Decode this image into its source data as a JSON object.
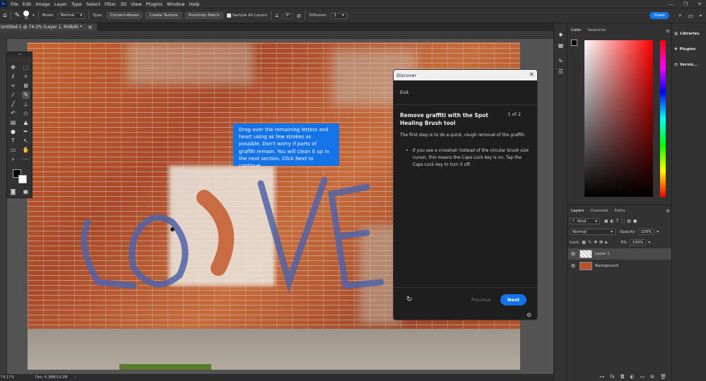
{
  "app": {
    "logo_text": "Ps"
  },
  "menu": [
    "File",
    "Edit",
    "Image",
    "Layer",
    "Type",
    "Select",
    "Filter",
    "3D",
    "View",
    "Plugins",
    "Window",
    "Help"
  ],
  "window_controls": {
    "minimize": "—",
    "restore": "❐",
    "close": "✕"
  },
  "options": {
    "brush_size": "50",
    "mode_label": "Mode:",
    "mode_value": "Normal",
    "type_label": "Type:",
    "type_buttons": [
      "Content-Aware",
      "Create Texture",
      "Proximity Match"
    ],
    "sample_all_layers": "Sample All Layers",
    "angle_value": "0°",
    "diffusion_label": "Diffusion:",
    "diffusion_value": "1",
    "share_label": "Share"
  },
  "document": {
    "tab_title": "Untitled-1 @ 74.2% (Layer 1, RGB/8) *",
    "tab_close": "×",
    "zoom": "74.17%",
    "doc_size": "Doc: 6.38M/10.2M"
  },
  "graffiti_letters": [
    "L",
    "O",
    "V",
    "E"
  ],
  "tooltip": {
    "text": "Drag over the remaining letters and heart using as few strokes as possible. Don't worry if parts of graffiti remain. You will clean it up in the next section. Click Next to continue."
  },
  "discover": {
    "header": "Discover",
    "exit": "Exit",
    "title": "Remove graffiti with the Spot Healing Brush tool",
    "step": "1 of 2",
    "paragraph": "The first step is to do a quick, rough removal of the graffiti.",
    "bullet": "If you see a crosshair instead of the circular brush size cursor, this means the Caps Lock key is on. Tap the Caps Lock key to turn it off.",
    "previous": "Previous",
    "next": "Next"
  },
  "color_panel": {
    "tabs": [
      "Color",
      "Swatches"
    ]
  },
  "layers_panel": {
    "tabs": [
      "Layers",
      "Channels",
      "Paths"
    ],
    "kind_label": "Kind",
    "blend_mode": "Normal",
    "opacity_label": "Opacity:",
    "opacity_value": "100%",
    "lock_label": "Lock:",
    "fill_label": "Fill:",
    "fill_value": "100%",
    "layers": [
      {
        "name": "Layer 1",
        "selected": true
      },
      {
        "name": "Background",
        "selected": false
      }
    ]
  },
  "right_dock": {
    "items": [
      "Libraries",
      "Plugins",
      "Versio..."
    ]
  }
}
